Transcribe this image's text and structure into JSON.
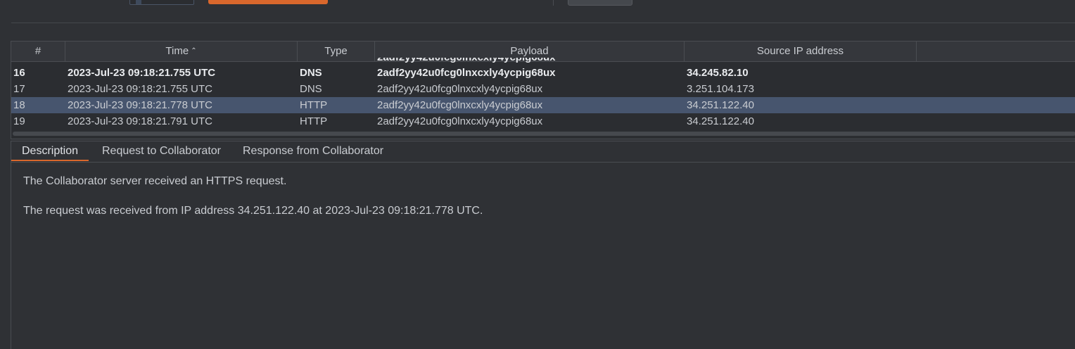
{
  "table": {
    "columns": [
      "#",
      "Time",
      "Type",
      "Payload",
      "Source IP address"
    ],
    "sort_icon": "caret-up-icon",
    "clipped_row_payload": "2adf2yy42u0fcg0lnxcxly4ycpig68ux",
    "rows": [
      {
        "num": "16",
        "time": "2023-Jul-23 09:18:21.755 UTC",
        "type": "DNS",
        "payload": "2adf2yy42u0fcg0lnxcxly4ycpig68ux",
        "ip": "34.245.82.10"
      },
      {
        "num": "17",
        "time": "2023-Jul-23 09:18:21.755 UTC",
        "type": "DNS",
        "payload": "2adf2yy42u0fcg0lnxcxly4ycpig68ux",
        "ip": "3.251.104.173"
      },
      {
        "num": "18",
        "time": "2023-Jul-23 09:18:21.778 UTC",
        "type": "HTTP",
        "payload": "2adf2yy42u0fcg0lnxcxly4ycpig68ux",
        "ip": "34.251.122.40"
      },
      {
        "num": "19",
        "time": "2023-Jul-23 09:18:21.791 UTC",
        "type": "HTTP",
        "payload": "2adf2yy42u0fcg0lnxcxly4ycpig68ux",
        "ip": "34.251.122.40"
      }
    ]
  },
  "detail": {
    "tabs": [
      "Description",
      "Request to Collaborator",
      "Response from Collaborator"
    ],
    "active_tab": "Description",
    "line1": "The Collaborator server received an HTTPS request.",
    "line2": "The request was received from IP address 34.251.122.40 at 2023-Jul-23 09:18:21.778 UTC."
  },
  "colors": {
    "accent": "#d9672c",
    "selected_row": "#47556e",
    "background": "#2f3135"
  }
}
